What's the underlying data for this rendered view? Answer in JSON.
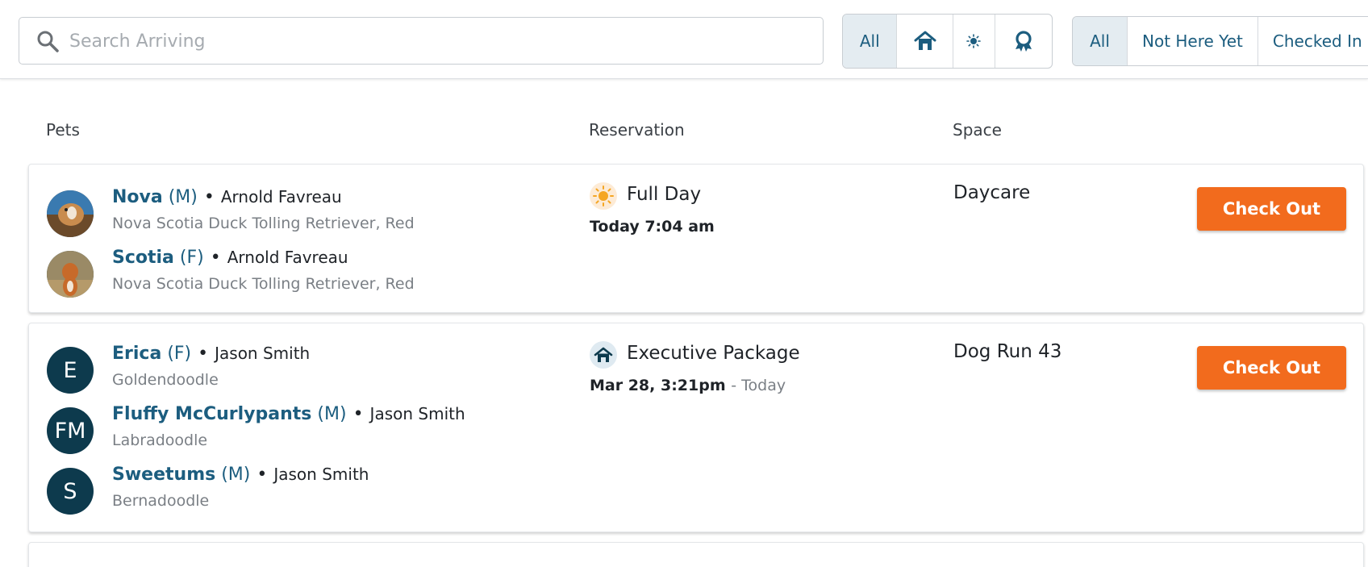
{
  "search": {
    "placeholder": "Search Arriving"
  },
  "filters_type": [
    {
      "label": "All",
      "active": true
    },
    {
      "icon": "house-icon"
    },
    {
      "icon": "sun-icon"
    },
    {
      "icon": "award-icon"
    }
  ],
  "filters_status": [
    {
      "label": "All",
      "active": true
    },
    {
      "label": "Not Here Yet"
    },
    {
      "label": "Checked In"
    }
  ],
  "columns": {
    "pets": "Pets",
    "reservation": "Reservation",
    "space": "Space"
  },
  "colors": {
    "brand": "#1c5d7f",
    "accent": "#f26b1d",
    "avatar": "#0d3a4d",
    "sun": "#f5a623"
  },
  "reservations": [
    {
      "pets": [
        {
          "name": "Nova",
          "sex": "(M)",
          "owner": "Arnold Favreau",
          "breed": "Nova Scotia Duck Tolling Retriever, Red",
          "avatar": "photo"
        },
        {
          "name": "Scotia",
          "sex": "(F)",
          "owner": "Arnold Favreau",
          "breed": "Nova Scotia Duck Tolling Retriever, Red",
          "avatar": "photo"
        }
      ],
      "reservation": {
        "icon": "sun-icon",
        "title": "Full Day",
        "time": "Today 7:04 am",
        "time_extra": ""
      },
      "space": "Daycare",
      "action": "Check Out"
    },
    {
      "pets": [
        {
          "name": "Erica",
          "sex": "(F)",
          "owner": "Jason Smith",
          "breed": "Goldendoodle",
          "initials": "E"
        },
        {
          "name": "Fluffy McCurlypants",
          "sex": "(M)",
          "owner": "Jason Smith",
          "breed": "Labradoodle",
          "initials": "FM"
        },
        {
          "name": "Sweetums",
          "sex": "(M)",
          "owner": "Jason Smith",
          "breed": "Bernadoodle",
          "initials": "S"
        }
      ],
      "reservation": {
        "icon": "house-icon",
        "title": "Executive Package",
        "time": "Mar 28, 3:21pm",
        "time_extra": "- Today"
      },
      "space": "Dog Run 43",
      "action": "Check Out"
    }
  ]
}
